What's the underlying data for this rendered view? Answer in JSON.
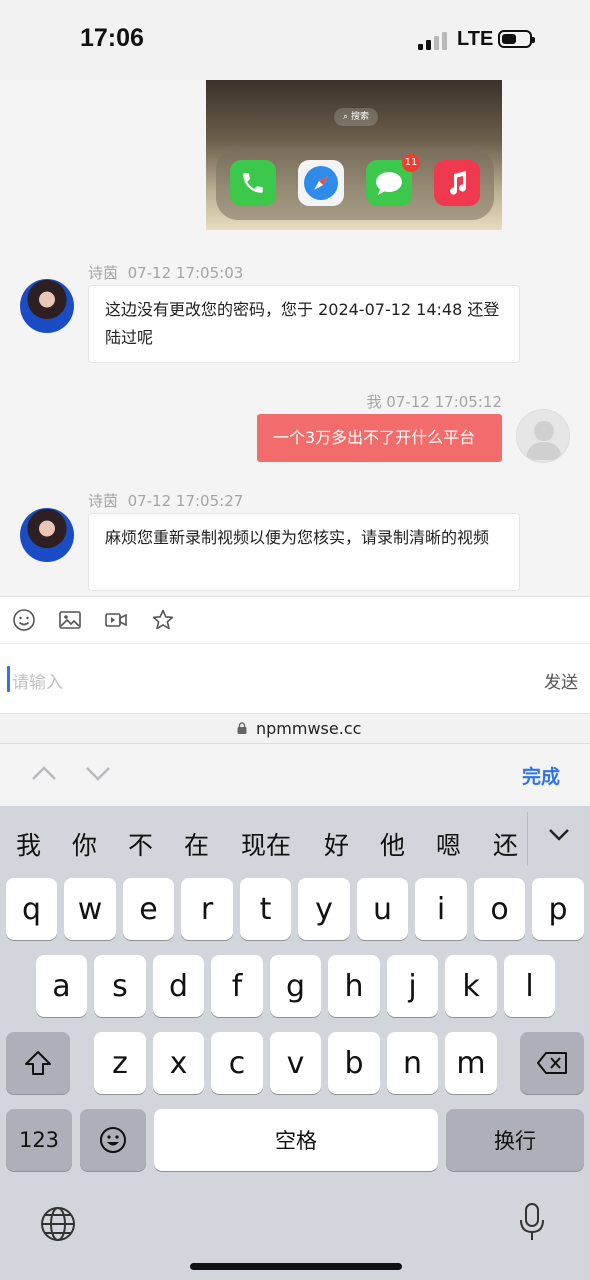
{
  "status": {
    "time": "17:06",
    "network": "LTE"
  },
  "chat": {
    "shared_image": {
      "search_label": "⌕ 搜索",
      "message_badge": "11"
    },
    "messages": [
      {
        "sender": "诗茵",
        "time": "07-12 17:05:03",
        "text": "这边没有更改您的密码，您于 2024-07-12 14:48 还登陆过呢",
        "side": "left"
      },
      {
        "sender": "我",
        "time": "07-12 17:05:12",
        "text": "一个3万多出不了开什么平台",
        "side": "right"
      },
      {
        "sender": "诗茵",
        "time": "07-12 17:05:27",
        "text": "麻烦您重新录制视频以便为您核实，请录制清晰的视频",
        "side": "left"
      }
    ]
  },
  "composer": {
    "placeholder": "请输入",
    "send_label": "发送"
  },
  "browser": {
    "url": "npmmwse.cc"
  },
  "accessory": {
    "done_label": "完成"
  },
  "keyboard": {
    "candidates": [
      "我",
      "你",
      "不",
      "在",
      "现在",
      "好",
      "他",
      "嗯",
      "还"
    ],
    "row1": [
      "q",
      "w",
      "e",
      "r",
      "t",
      "y",
      "u",
      "i",
      "o",
      "p"
    ],
    "row2": [
      "a",
      "s",
      "d",
      "f",
      "g",
      "h",
      "j",
      "k",
      "l"
    ],
    "row3": [
      "z",
      "x",
      "c",
      "v",
      "b",
      "n",
      "m"
    ],
    "numbers_label": "123",
    "space_label": "空格",
    "return_label": "换行"
  },
  "colors": {
    "accent": "#2f73e6",
    "outgoing_bubble": "#f26c6c"
  }
}
